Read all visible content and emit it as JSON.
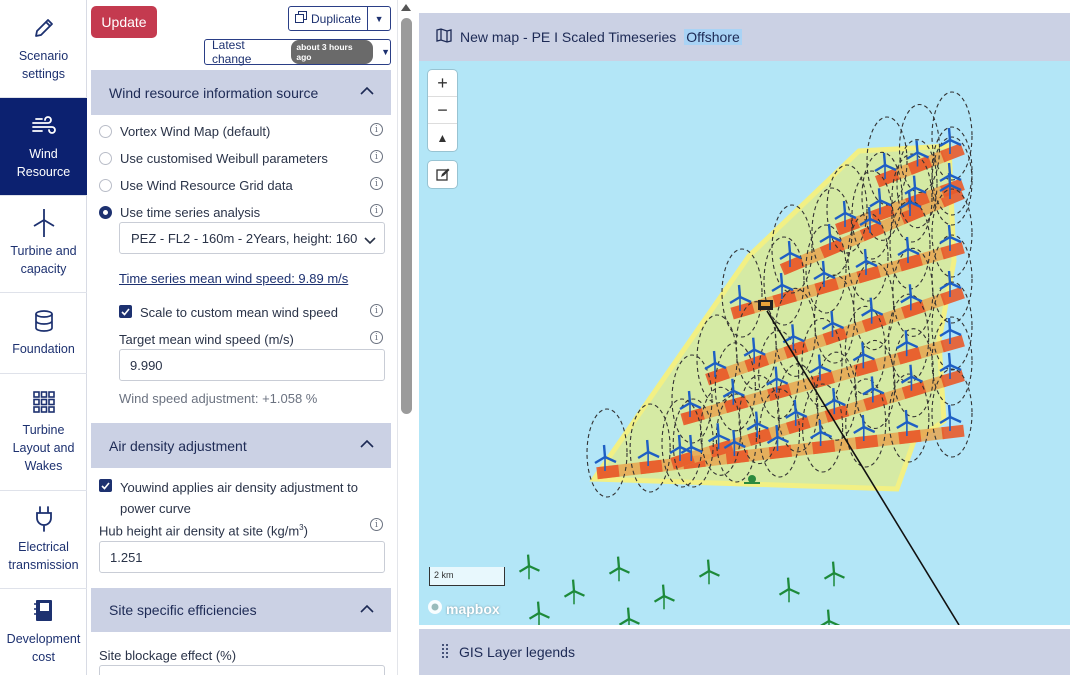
{
  "nav": {
    "items": [
      {
        "label_1": "Scenario",
        "label_2": "settings",
        "icon": "pencil-icon"
      },
      {
        "label_1": "Wind",
        "label_2": "Resource",
        "icon": "wind-icon"
      },
      {
        "label_1": "Turbine and",
        "label_2": "capacity",
        "icon": "turbine-icon"
      },
      {
        "label_1": "Foundation",
        "label_2": "",
        "icon": "database-icon"
      },
      {
        "label_1": "Turbine",
        "label_2": "Layout and",
        "label_3": "Wakes",
        "icon": "grid-icon"
      },
      {
        "label_1": "Electrical",
        "label_2": "transmission",
        "icon": "plug-icon"
      },
      {
        "label_1": "Development",
        "label_2": "cost",
        "icon": "book-icon"
      }
    ]
  },
  "toolbar": {
    "update_label": "Update",
    "duplicate_label": "Duplicate",
    "latest_change_label": "Latest change",
    "latest_change_badge": "about 3 hours ago"
  },
  "wind_resource": {
    "title": "Wind resource information source",
    "options": [
      {
        "label": "Vortex Wind Map (default)",
        "selected": false
      },
      {
        "label": "Use customised Weibull parameters",
        "selected": false
      },
      {
        "label": "Use Wind Resource Grid data",
        "selected": false
      },
      {
        "label": "Use time series analysis",
        "selected": true
      }
    ],
    "timeseries_select": "PEZ - FL2 - 160m - 2Years, height: 160",
    "mean_speed_link": "Time series mean wind speed: 9.89 m/s",
    "scale_checkbox_label": "Scale to custom mean wind speed",
    "target_label": "Target mean wind speed (m/s)",
    "target_value": "9.990",
    "adjustment_text": "Wind speed adjustment: +1.058 %"
  },
  "air_density": {
    "title": "Air density adjustment",
    "checkbox_label_1": "Youwind applies air density adjustment to",
    "checkbox_label_2": "power curve",
    "hub_label": "Hub height air density at site (kg/m",
    "hub_label_sup": "3",
    "hub_label_end": ")",
    "hub_value": "1.251"
  },
  "efficiencies": {
    "title": "Site specific efficiencies",
    "blockage_label": "Site blockage effect (%)"
  },
  "map": {
    "title_main": "New map - PE I Scaled Timeseries",
    "title_highlight": "Offshore",
    "scale_label": "2 km",
    "attribution": "mapbox",
    "legend_label": "GIS Layer legends"
  },
  "colors": {
    "nav_active": "#0c2170",
    "update_button": "#c43a4f",
    "section_header": "#cbd1e4",
    "water": "#b3e6f7"
  }
}
